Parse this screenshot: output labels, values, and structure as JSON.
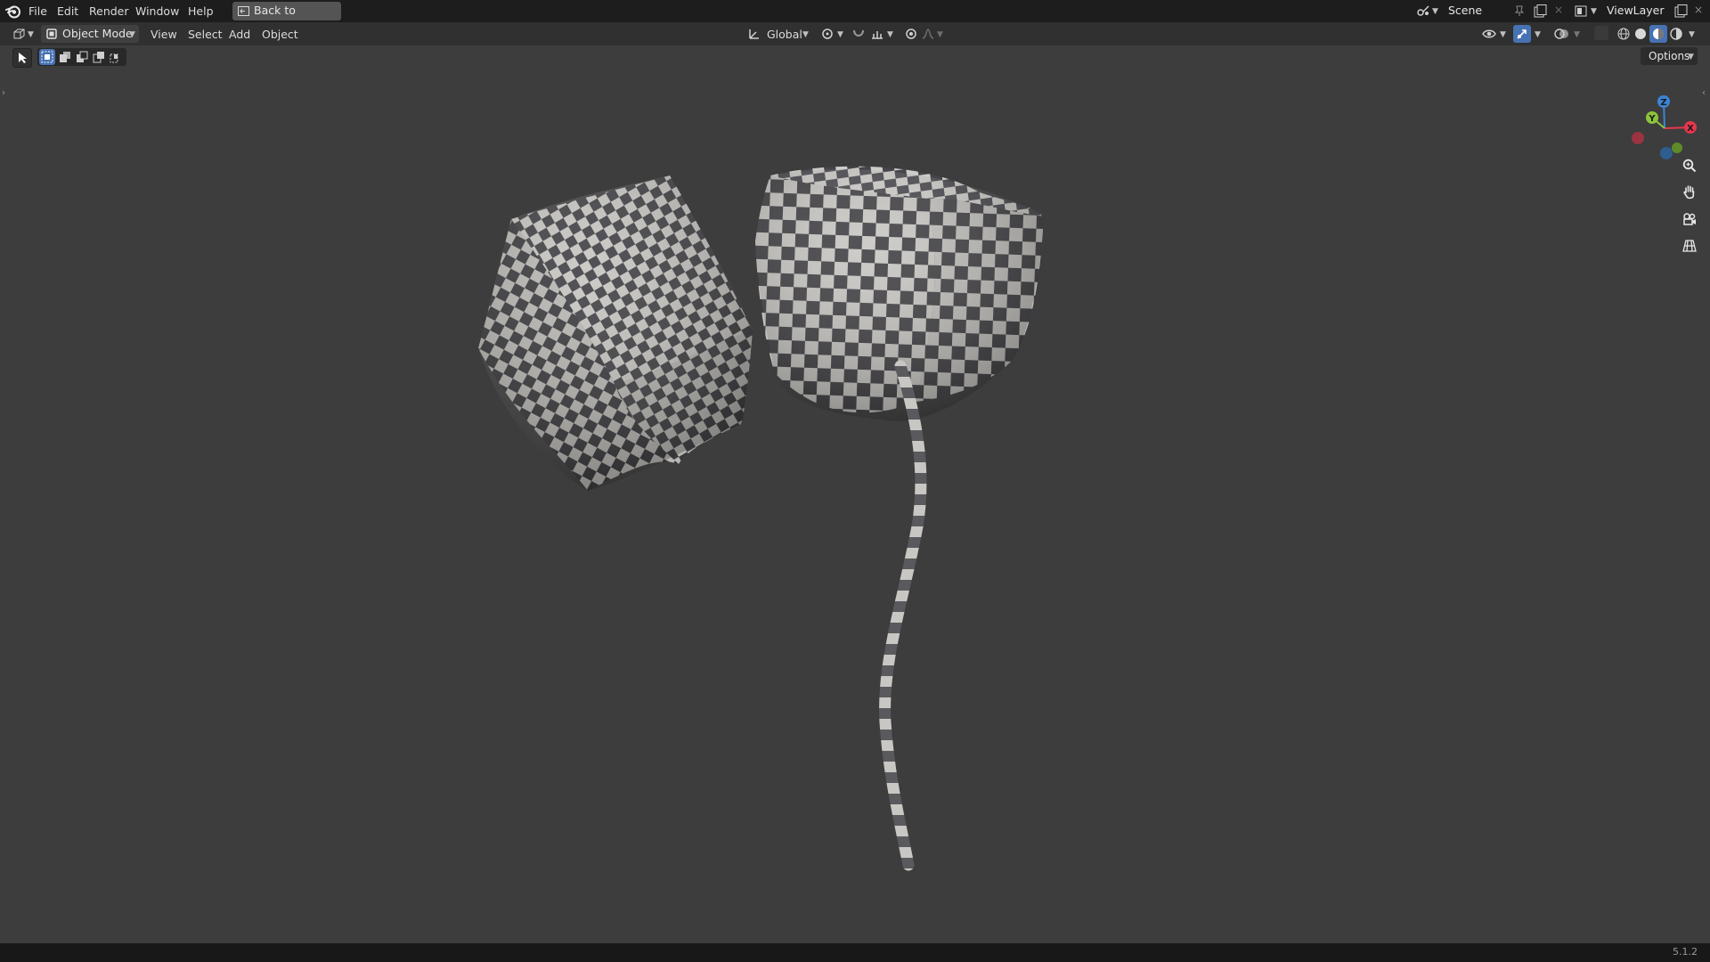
{
  "topbar": {
    "menus": [
      "File",
      "Edit",
      "Render",
      "Window",
      "Help"
    ],
    "back_button": "Back to Previous",
    "scene_label": "Scene",
    "viewlayer_label": "ViewLayer"
  },
  "header": {
    "mode": "Object Mode",
    "menus": [
      "View",
      "Select",
      "Add",
      "Object"
    ],
    "orientation": "Global",
    "options_label": "Options"
  },
  "gizmo": {
    "x": "X",
    "y": "Y",
    "z": "Z"
  },
  "status": {
    "version": "5.1.2"
  },
  "colors": {
    "background": "#3d3d3d",
    "topbar": "#1d1d1d",
    "header": "#303030",
    "accent_blue": "#4772b3",
    "axis_x": "#e5374d",
    "axis_y": "#8bc43a",
    "axis_z": "#3c85d6"
  },
  "icons": {
    "app": "blender-logo-icon",
    "editor": "3d-viewport-icon",
    "zoom": "zoom-icon",
    "pan": "hand-icon",
    "camera": "camera-icon",
    "grid": "ortho-grid-icon"
  }
}
